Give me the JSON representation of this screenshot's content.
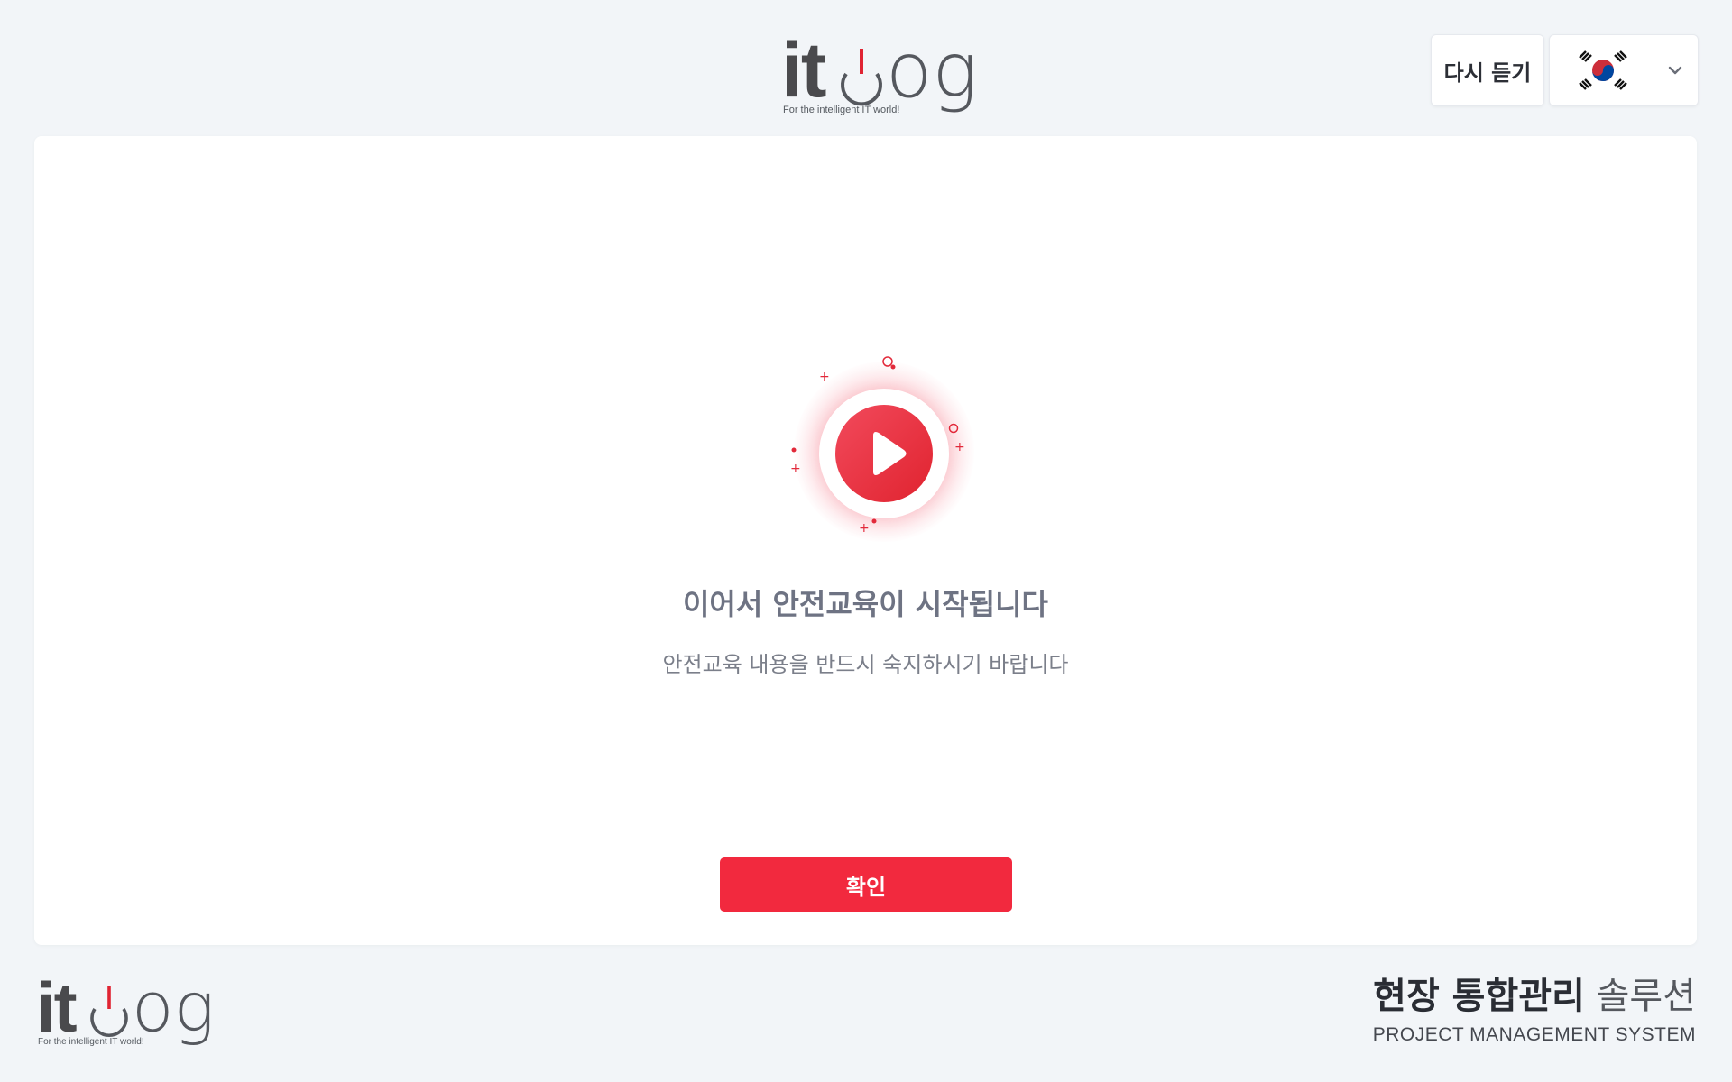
{
  "header": {
    "logo": {
      "it": "it",
      "og": "og",
      "tagline": "For the intelligent IT world!"
    },
    "replay_label": "다시 듣기",
    "language_icon": "korea-flag-icon",
    "chevron_icon": "chevron-down-icon"
  },
  "main": {
    "play_icon": "play-icon",
    "title": "이어서 안전교육이 시작됩니다",
    "subtitle": "안전교육 내용을 반드시 숙지하시기 바랍니다",
    "confirm_label": "확인"
  },
  "footer": {
    "logo": {
      "it": "it",
      "og": "og",
      "tagline": "For the intelligent IT world!"
    },
    "title_bold": "현장 통합관리",
    "title_light": "솔루션",
    "subtitle": "PROJECT MANAGEMENT SYSTEM"
  },
  "colors": {
    "accent": "#f2293e",
    "background": "#f2f5f8",
    "text_muted": "#6e7383"
  }
}
